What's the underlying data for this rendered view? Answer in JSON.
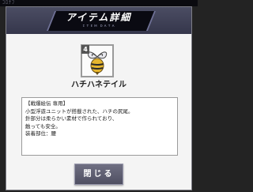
{
  "top_strip": {
    "text": "ｺﾛﾅﾌ"
  },
  "dialog": {
    "title": "アイテム詳細",
    "subtitle": "ＩＴＥＭ ＤＡＴＡ"
  },
  "item": {
    "icon": "bee-tail-icon",
    "badge": "4",
    "name": "ハチハネテイル",
    "description": [
      "【戦爆絵伝 専用】",
      "小型浮遊ユニットが搭載された、ハチの尻尾。",
      "針部分は柔らかい素材で作られており、",
      "触っても安全。",
      "装着部位：腰"
    ]
  },
  "buttons": {
    "close_label": "閉じる"
  },
  "colors": {
    "header": "#3f4156",
    "button": "#5f5f72",
    "panel": "#f4f4f4"
  }
}
